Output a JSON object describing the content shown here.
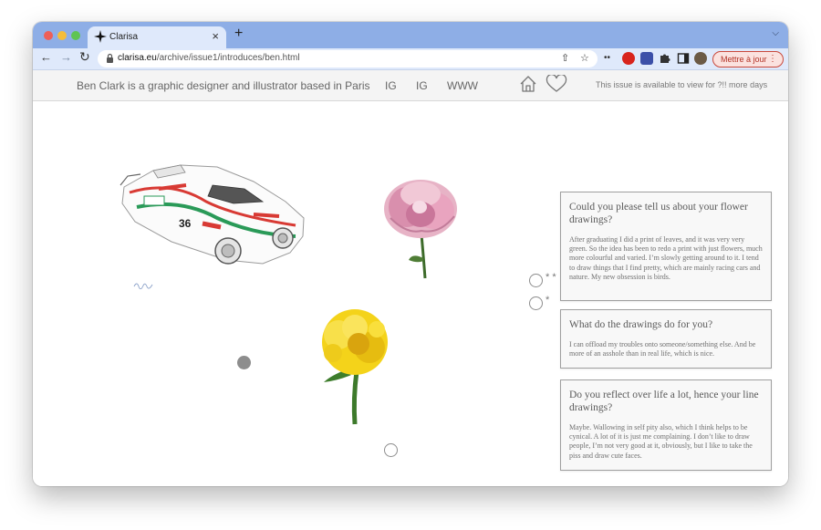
{
  "browser": {
    "tab_title": "Clarisa",
    "new_tab_symbol": "+",
    "tab_close_symbol": "×",
    "url_host": "clarisa.eu",
    "url_path": "/archive/issue1/introduces/ben.html",
    "update_button_label": "Mettre à jour",
    "icons": [
      "back-arrow-icon",
      "forward-arrow-icon",
      "reload-icon",
      "lock-icon",
      "share-icon",
      "star-icon",
      "extension-icons",
      "puzzle-icon",
      "sidebar-icon",
      "profile-avatar"
    ]
  },
  "header": {
    "bio": "Ben Clark is a graphic designer and illustrator based in Paris",
    "links": [
      "IG",
      "IG",
      "WWW"
    ],
    "availability": "This issue is available to view for ?!! more days"
  },
  "qa": [
    {
      "question": "Could you please tell us about your flower drawings?",
      "answer": "After graduating I did a print of leaves, and it was very very green. So the idea has been to redo a print with just flowers, much more colourful and varied. I’m slowly getting around to it. I tend to draw things that I find pretty, which are mainly racing cars and nature. My new obsession is birds."
    },
    {
      "question": "What do the drawings do for you?",
      "answer": "I can offload my troubles onto someone/something else. And be more of an asshole than in real life, which is nice."
    },
    {
      "question": "Do you reflect over life a lot, hence your line drawings?",
      "answer": "Maybe. Wallowing in self pity also, which I think helps to be cynical. A lot of it is just me complaining. I don’t like to draw people, I’m not very good at it, obviously, but I like to take the piss and draw cute faces."
    }
  ],
  "markers": {
    "star_single": "*",
    "star_double": "* *"
  },
  "colors": {
    "tab_strip": "#8eaee6",
    "toolbar": "#dfe9fb",
    "update_accent": "#c9483b"
  }
}
